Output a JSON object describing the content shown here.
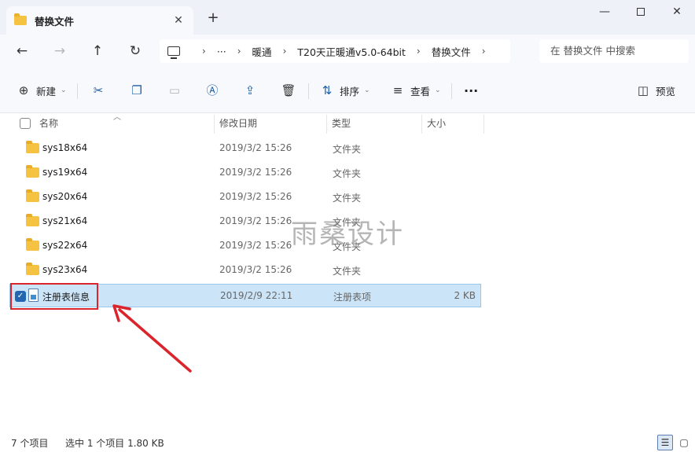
{
  "window": {
    "tab_title": "替换文件",
    "new_tab_glyph": "+",
    "close_tab_glyph": "✕",
    "minimize_glyph": "—",
    "close_glyph": "✕"
  },
  "nav": {
    "back": "←",
    "forward": "→",
    "up": "↑",
    "refresh": "↻",
    "ellipsis": "···",
    "breadcrumb": [
      "暖通",
      "T20天正暖通v5.0-64bit",
      "替换文件"
    ],
    "separator": "›",
    "search_placeholder": "在 替换文件 中搜索"
  },
  "commands": {
    "new": "新建",
    "sort": "排序",
    "view": "查看",
    "more": "···",
    "preview": "预览"
  },
  "columns": {
    "name": "名称",
    "date": "修改日期",
    "type": "类型",
    "size": "大小"
  },
  "files": [
    {
      "name": "sys18x64",
      "date": "2019/3/2 15:26",
      "type": "文件夹",
      "size": ""
    },
    {
      "name": "sys19x64",
      "date": "2019/3/2 15:26",
      "type": "文件夹",
      "size": ""
    },
    {
      "name": "sys20x64",
      "date": "2019/3/2 15:26",
      "type": "文件夹",
      "size": ""
    },
    {
      "name": "sys21x64",
      "date": "2019/3/2 15:26",
      "type": "文件夹",
      "size": ""
    },
    {
      "name": "sys22x64",
      "date": "2019/3/2 15:26",
      "type": "文件夹",
      "size": ""
    },
    {
      "name": "sys23x64",
      "date": "2019/3/2 15:26",
      "type": "文件夹",
      "size": ""
    },
    {
      "name": "注册表信息",
      "date": "2019/2/9 22:11",
      "type": "注册表项",
      "size": "2 KB"
    }
  ],
  "status": {
    "count": "7 个项目",
    "selected": "选中 1 个项目  1.80 KB"
  },
  "watermark": "雨桑设计",
  "colors": {
    "accent": "#2566b1",
    "selection": "#cce4f7",
    "annotation_red": "#d9252b",
    "folder": "#f6c242"
  }
}
